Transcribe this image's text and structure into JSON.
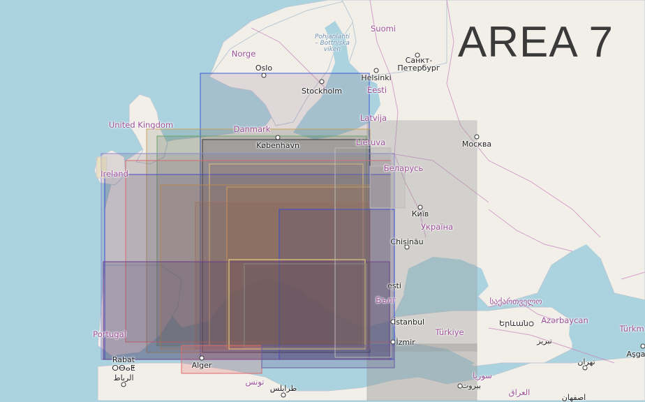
{
  "title": "AREA 7",
  "colors": {
    "sea": "#aad3df",
    "land": "#f2efe9",
    "border": "#c77fbd",
    "overlay_grey": "#999999"
  },
  "countries": [
    {
      "key": "suomi",
      "label": "Suomi"
    },
    {
      "key": "norge",
      "label": "Norge"
    },
    {
      "key": "uk",
      "label": "United Kingdom"
    },
    {
      "key": "danmark",
      "label": "Danmark"
    },
    {
      "key": "eesti",
      "label": "Eesti"
    },
    {
      "key": "latvija",
      "label": "Latvija"
    },
    {
      "key": "lietuva",
      "label": "Lietuva"
    },
    {
      "key": "ireland",
      "label": "Ireland"
    },
    {
      "key": "belarus",
      "label": "Беларусь"
    },
    {
      "key": "ukraina",
      "label": "Україна"
    },
    {
      "key": "portugal",
      "label": "Portugal"
    },
    {
      "key": "turkiye",
      "label": "Türkiye"
    },
    {
      "key": "georgia",
      "label": "საქართველო"
    },
    {
      "key": "azerbaycan",
      "label": "Azərbaycan"
    },
    {
      "key": "turkm",
      "label": "Türkm"
    },
    {
      "key": "suriya",
      "label": "سوريا"
    },
    {
      "key": "iraq",
      "label": "العراق"
    },
    {
      "key": "algeria_ar",
      "label": "تونس"
    },
    {
      "key": "bulg",
      "label": "Бълг"
    }
  ],
  "cities": [
    {
      "key": "oslo",
      "label": "Oslo"
    },
    {
      "key": "stockholm",
      "label": "Stockholm"
    },
    {
      "key": "helsinki",
      "label": "Helsinki"
    },
    {
      "key": "spb",
      "label": "Санкт-Петербург"
    },
    {
      "key": "moskva",
      "label": "Москва"
    },
    {
      "key": "kobenhavn",
      "label": "København"
    },
    {
      "key": "kyiv",
      "label": "Київ"
    },
    {
      "key": "chisinau",
      "label": "Chișinău"
    },
    {
      "key": "bucuresti",
      "label": "ești"
    },
    {
      "key": "istanbul",
      "label": "İstanbul"
    },
    {
      "key": "izmir",
      "label": "İzmir"
    },
    {
      "key": "yerevan",
      "label": "Երևան"
    },
    {
      "key": "tabriz",
      "label": "تبریز"
    },
    {
      "key": "tehran",
      "label": "تهران"
    },
    {
      "key": "beirut",
      "label": "بيروت"
    },
    {
      "key": "asgabat",
      "label": "Aşga"
    },
    {
      "key": "alger",
      "label": "Alger"
    },
    {
      "key": "rabat",
      "label": "Rabat"
    },
    {
      "key": "rabat_tif",
      "label": "ⵔⴱⴰⵟ"
    },
    {
      "key": "rabat_ar",
      "label": "الرباط"
    },
    {
      "key": "tarabulus",
      "label": "طرابلس"
    },
    {
      "key": "isfahan",
      "label": "اصفهان"
    }
  ],
  "seas": [
    {
      "key": "bothnia",
      "label": "Pohjanlahti\n– Bottniska\nviken"
    }
  ]
}
